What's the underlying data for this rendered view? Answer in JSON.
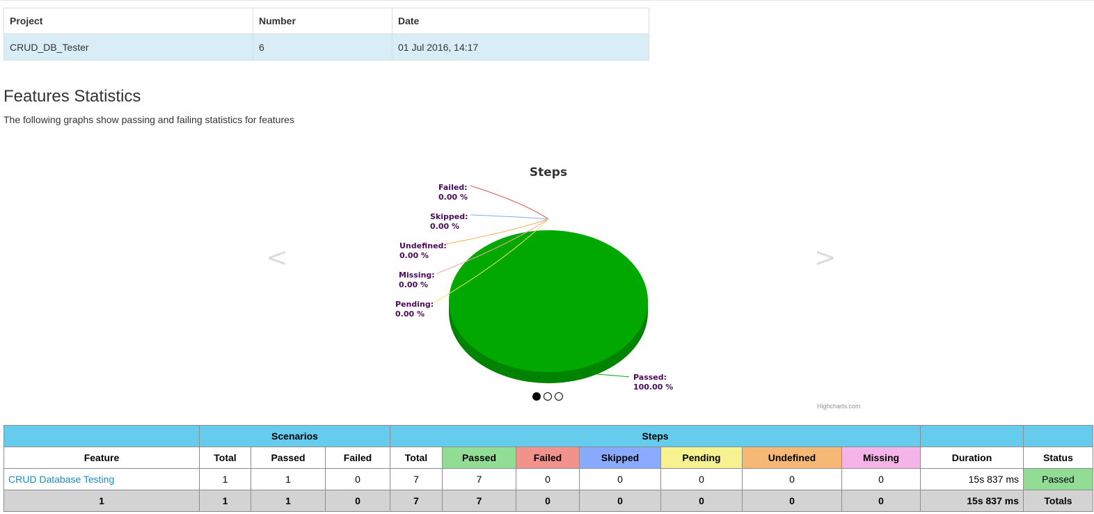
{
  "project_table": {
    "headers": [
      "Project",
      "Number",
      "Date"
    ],
    "row": [
      "CRUD_DB_Tester",
      "6",
      "01 Jul 2016, 14:17"
    ]
  },
  "section": {
    "title": "Features Statistics",
    "description": "The following graphs show passing and failing statistics for features"
  },
  "chart_data": {
    "type": "pie",
    "title": "Steps",
    "slices": [
      {
        "name": "Passed",
        "value": 100.0,
        "label": "100.00 %",
        "color": "#00a800"
      },
      {
        "name": "Failed",
        "value": 0.0,
        "label": "0.00 %",
        "color": "#d9534f"
      },
      {
        "name": "Skipped",
        "value": 0.0,
        "label": "0.00 %",
        "color": "#88aaee"
      },
      {
        "name": "Undefined",
        "value": 0.0,
        "label": "0.00 %",
        "color": "#f0ad4e"
      },
      {
        "name": "Missing",
        "value": 0.0,
        "label": "0.00 %",
        "color": "#f5a0a0"
      },
      {
        "name": "Pending",
        "value": 0.0,
        "label": "0.00 %",
        "color": "#f2e36a"
      }
    ],
    "credits": "Highcharts.com",
    "label_color": "#4b0a5a"
  },
  "carousel": {
    "prev": "<",
    "next": ">",
    "dots": 3,
    "active_index": 0
  },
  "stats_table": {
    "group_headers": {
      "scenarios": "Scenarios",
      "steps": "Steps"
    },
    "headers": {
      "feature": "Feature",
      "sc_total": "Total",
      "sc_passed": "Passed",
      "sc_failed": "Failed",
      "st_total": "Total",
      "st_passed": "Passed",
      "st_failed": "Failed",
      "st_skipped": "Skipped",
      "st_pending": "Pending",
      "st_undefined": "Undefined",
      "st_missing": "Missing",
      "duration": "Duration",
      "status": "Status"
    },
    "row": {
      "feature": "CRUD Database Testing",
      "sc_total": "1",
      "sc_passed": "1",
      "sc_failed": "0",
      "st_total": "7",
      "st_passed": "7",
      "st_failed": "0",
      "st_skipped": "0",
      "st_pending": "0",
      "st_undefined": "0",
      "st_missing": "0",
      "duration": "15s 837 ms",
      "status": "Passed"
    },
    "totals": {
      "feature": "1",
      "sc_total": "1",
      "sc_passed": "1",
      "sc_failed": "0",
      "st_total": "7",
      "st_passed": "7",
      "st_failed": "0",
      "st_skipped": "0",
      "st_pending": "0",
      "st_undefined": "0",
      "st_missing": "0",
      "duration": "15s 837 ms",
      "status": "Totals"
    }
  }
}
